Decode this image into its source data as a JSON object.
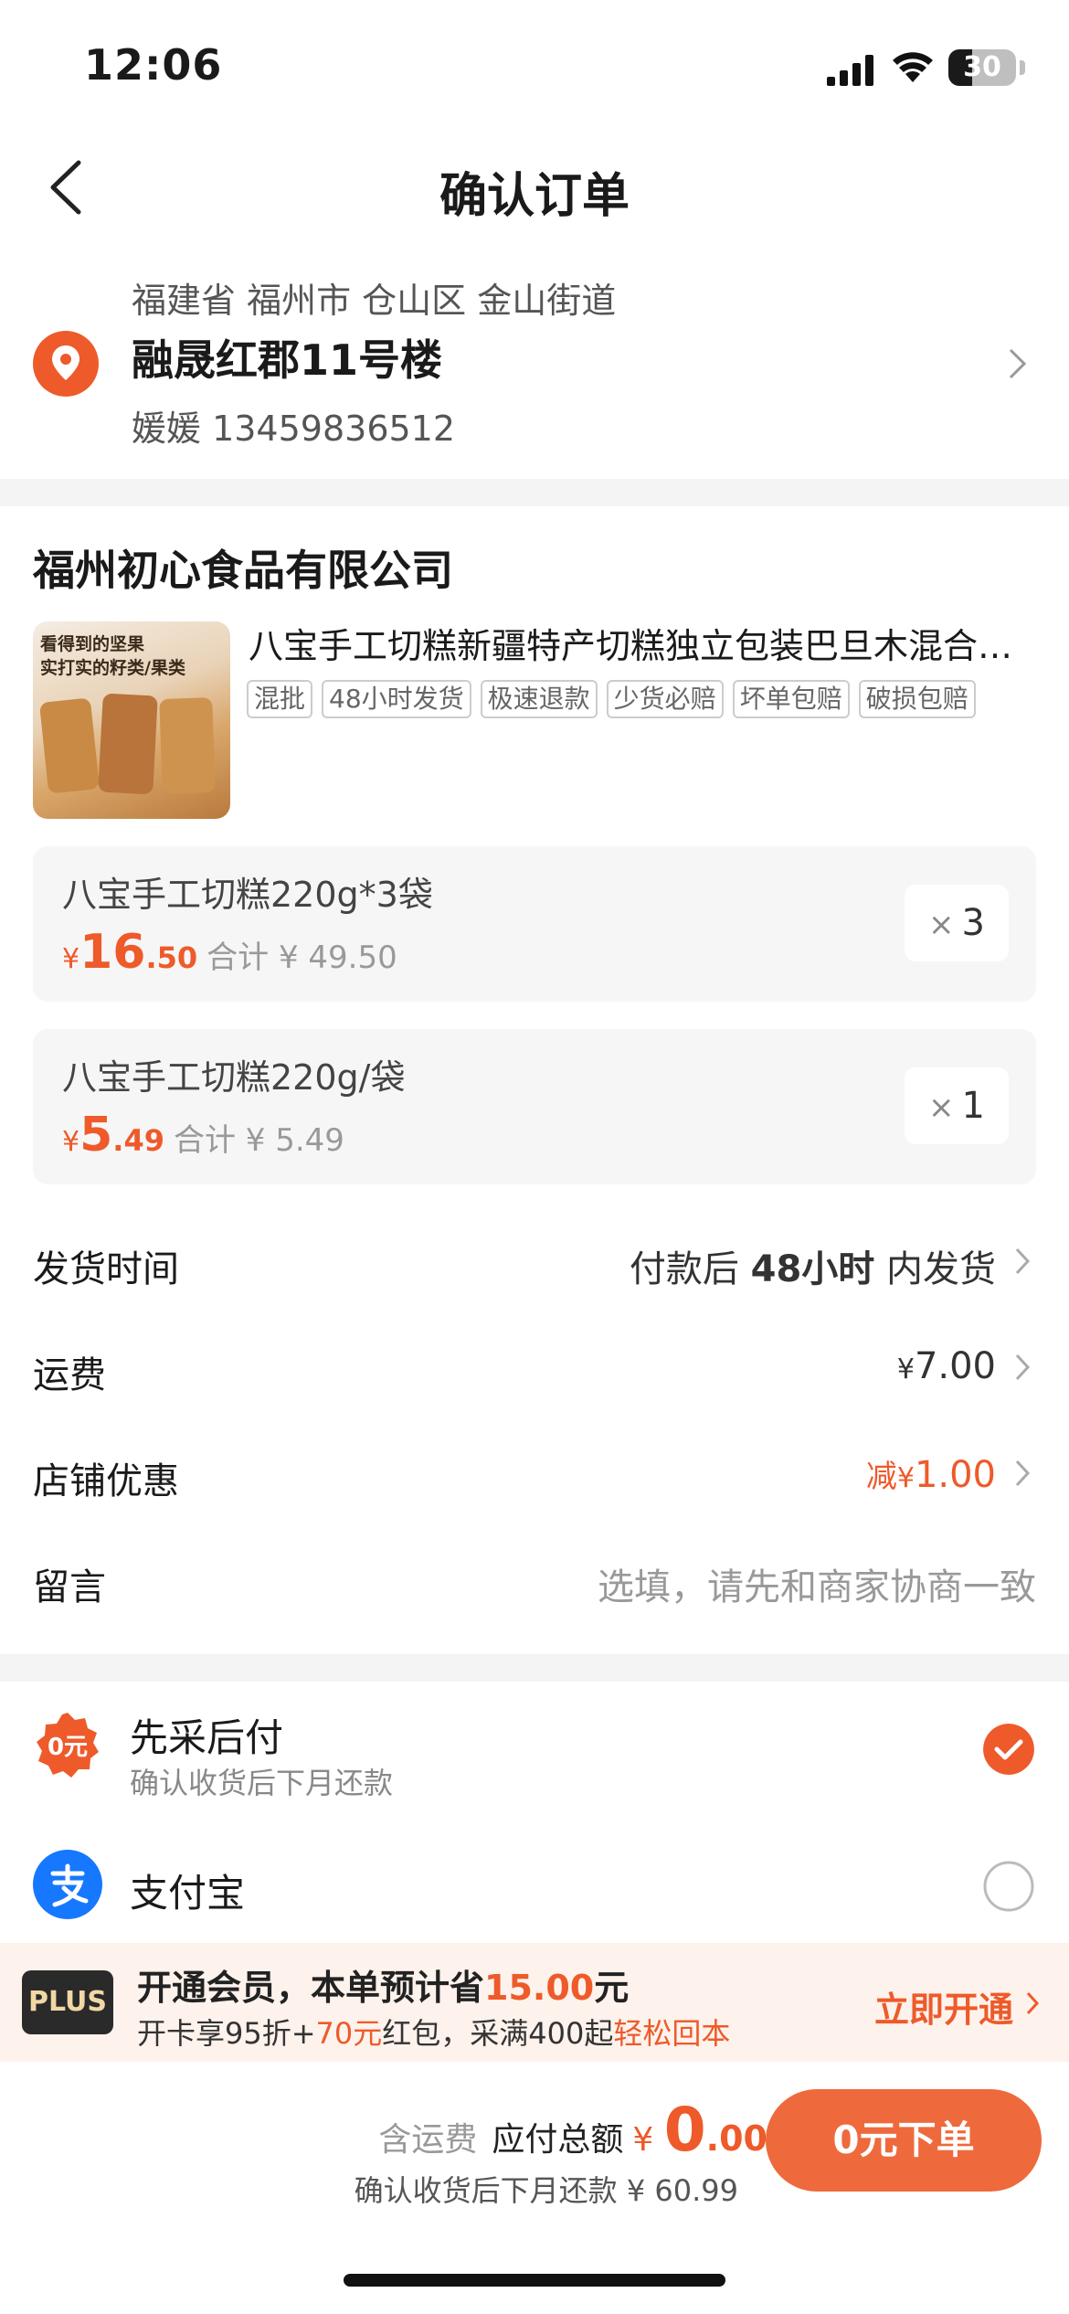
{
  "status": {
    "time": "12:06",
    "battery": "30"
  },
  "nav": {
    "title": "确认订单"
  },
  "address": {
    "region": "福建省 福州市 仓山区 金山街道",
    "detail": "融晟红郡11号楼",
    "contact": "媛媛   13459836512"
  },
  "shop": {
    "name": "福州初心食品有限公司"
  },
  "product": {
    "image_text_1": "看得到的坚果",
    "image_text_2": "实打实的籽类/果类",
    "title": "八宝手工切糕新疆特产切糕独立包装巴旦木混合坚果零食",
    "tags": [
      "混批",
      "48小时发货",
      "极速退款",
      "少货必赔",
      "坏单包赔",
      "破损包赔"
    ]
  },
  "skus": [
    {
      "name": "八宝手工切糕220g*3袋",
      "yen": "¥",
      "price_int": "16",
      "price_dec": ".50",
      "total": "合计 ¥ 49.50",
      "qty_x": "×",
      "qty": "3"
    },
    {
      "name": "八宝手工切糕220g/袋",
      "yen": "¥",
      "price_int": "5",
      "price_dec": ".49",
      "total": "合计 ¥ 5.49",
      "qty_x": "×",
      "qty": "1"
    }
  ],
  "rows": {
    "delivery": {
      "label": "发货时间",
      "prefix": "付款后 ",
      "hours": "48小时",
      "suffix": " 内发货"
    },
    "shipping": {
      "label": "运费",
      "yen": "¥",
      "value": "7.00"
    },
    "discount": {
      "label": "店铺优惠",
      "prefix": "减",
      "yen": "¥",
      "value": "1.00"
    },
    "message": {
      "label": "留言",
      "placeholder": "选填，请先和商家协商一致"
    }
  },
  "payment": {
    "option1": {
      "title": "先采后付",
      "subtitle": "确认收货后下月还款",
      "badge": "0元",
      "selected": true
    },
    "option2": {
      "title": "支付宝",
      "selected": false
    }
  },
  "promo": {
    "badge": "PLUS",
    "line1_a": "开通会员，本单预计省",
    "line1_amount": "15.00",
    "line1_b": "元",
    "line2_a": "开卡享95折+",
    "line2_amount": "70元",
    "line2_b": "红包，采满400起",
    "line2_hl": "轻松回本",
    "cta": "立即开通"
  },
  "footer": {
    "shipping_note": "含运费",
    "total_label": "应付总额",
    "yen": "¥",
    "total_int": "0",
    "total_dec": ".00",
    "later_note": "确认收货后下月还款 ¥ 60.99",
    "submit": "0元下单"
  },
  "colors": {
    "accent": "#ee5a2a",
    "button": "#ee6a3c",
    "alipay": "#1677ff"
  }
}
